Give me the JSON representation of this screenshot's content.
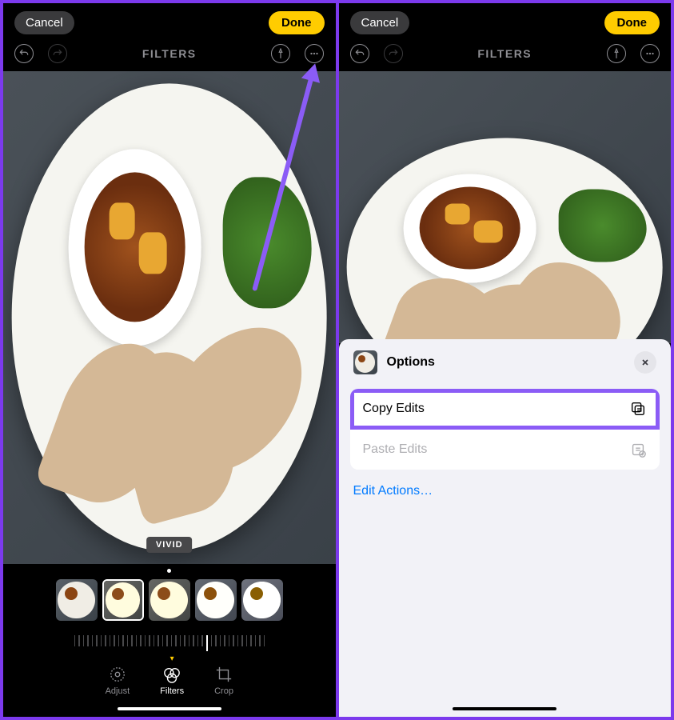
{
  "left": {
    "cancel": "Cancel",
    "done": "Done",
    "screen_title": "FILTERS",
    "filter_badge": "VIVID",
    "tabs": {
      "adjust": "Adjust",
      "filters": "Filters",
      "crop": "Crop"
    }
  },
  "right": {
    "cancel": "Cancel",
    "done": "Done",
    "screen_title": "FILTERS",
    "sheet": {
      "title": "Options",
      "copy_edits": "Copy Edits",
      "paste_edits": "Paste Edits",
      "edit_actions": "Edit Actions…"
    }
  }
}
